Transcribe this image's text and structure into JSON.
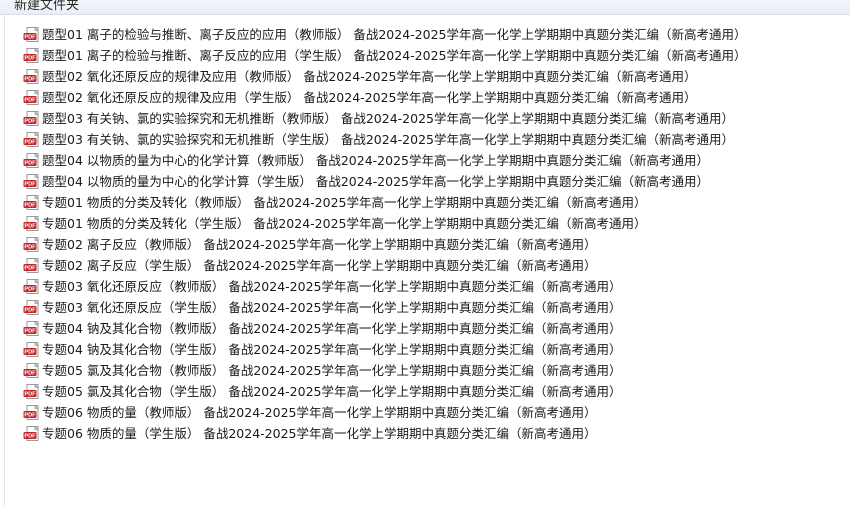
{
  "window": {
    "folder_title": "新建文件夹"
  },
  "icons": {
    "file_type": "pdf-icon",
    "file_type_label": "PDF",
    "icon_color": "#c0282d"
  },
  "files": [
    "题型01 离子的检验与推断、离子反应的应用（教师版） 备战2024-2025学年高一化学上学期期中真题分类汇编（新高考通用）",
    "题型01 离子的检验与推断、离子反应的应用（学生版） 备战2024-2025学年高一化学上学期期中真题分类汇编（新高考通用）",
    "题型02 氧化还原反应的规律及应用（教师版） 备战2024-2025学年高一化学上学期期中真题分类汇编（新高考通用）",
    "题型02 氧化还原反应的规律及应用（学生版） 备战2024-2025学年高一化学上学期期中真题分类汇编（新高考通用）",
    "题型03 有关钠、氯的实验探究和无机推断（教师版） 备战2024-2025学年高一化学上学期期中真题分类汇编（新高考通用）",
    "题型03 有关钠、氯的实验探究和无机推断（学生版） 备战2024-2025学年高一化学上学期期中真题分类汇编（新高考通用）",
    "题型04 以物质的量为中心的化学计算（教师版） 备战2024-2025学年高一化学上学期期中真题分类汇编（新高考通用）",
    "题型04 以物质的量为中心的化学计算（学生版） 备战2024-2025学年高一化学上学期期中真题分类汇编（新高考通用）",
    "专题01 物质的分类及转化（教师版） 备战2024-2025学年高一化学上学期期中真题分类汇编（新高考通用）",
    "专题01 物质的分类及转化（学生版） 备战2024-2025学年高一化学上学期期中真题分类汇编（新高考通用）",
    "专题02 离子反应（教师版） 备战2024-2025学年高一化学上学期期中真题分类汇编（新高考通用）",
    "专题02 离子反应（学生版） 备战2024-2025学年高一化学上学期期中真题分类汇编（新高考通用）",
    "专题03 氧化还原反应（教师版） 备战2024-2025学年高一化学上学期期中真题分类汇编（新高考通用）",
    "专题03 氧化还原反应（学生版） 备战2024-2025学年高一化学上学期期中真题分类汇编（新高考通用）",
    "专题04 钠及其化合物（教师版） 备战2024-2025学年高一化学上学期期中真题分类汇编（新高考通用）",
    "专题04 钠及其化合物（学生版） 备战2024-2025学年高一化学上学期期中真题分类汇编（新高考通用）",
    "专题05 氯及其化合物（教师版） 备战2024-2025学年高一化学上学期期中真题分类汇编（新高考通用）",
    "专题05 氯及其化合物（学生版） 备战2024-2025学年高一化学上学期期中真题分类汇编（新高考通用）",
    "专题06 物质的量（教师版） 备战2024-2025学年高一化学上学期期中真题分类汇编（新高考通用）",
    "专题06 物质的量（学生版） 备战2024-2025学年高一化学上学期期中真题分类汇编（新高考通用）"
  ]
}
